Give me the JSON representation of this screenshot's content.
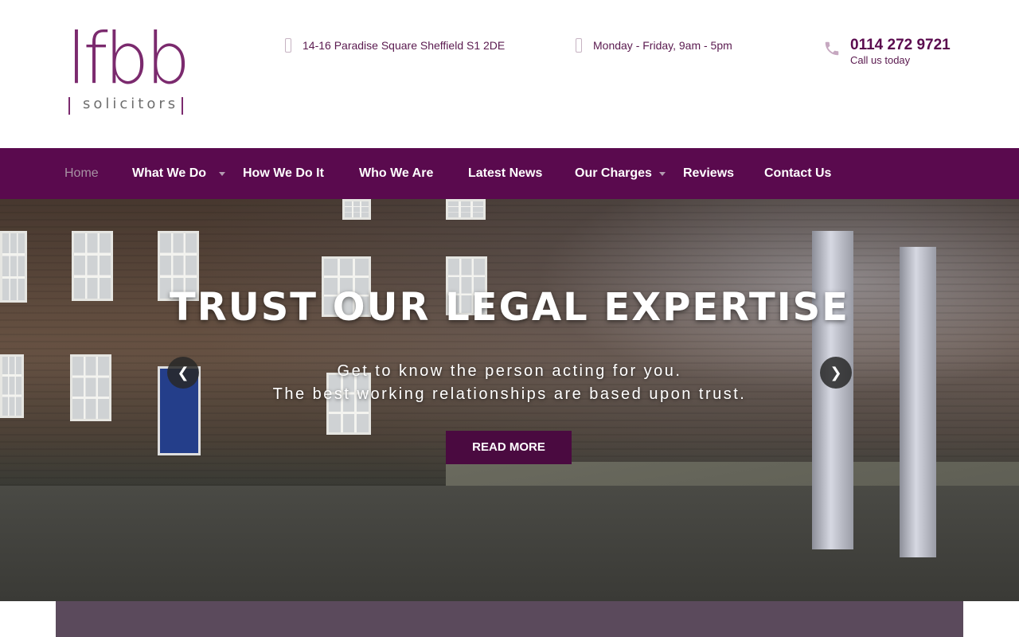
{
  "header": {
    "logo": {
      "word": "lfbb",
      "sub": "solicitors"
    },
    "address": "14-16 Paradise Square Sheffield S1 2DE",
    "hours": "Monday - Friday, 9am - 5pm",
    "phone": {
      "number": "0114 272 9721",
      "sub": "Call us today",
      "icon": "phone-icon"
    }
  },
  "nav": {
    "items": [
      {
        "label": "Home",
        "active": true
      },
      {
        "label": "What We Do",
        "has_dropdown": true
      },
      {
        "label": "How We Do It"
      },
      {
        "label": "Who We Are"
      },
      {
        "label": "Latest News"
      },
      {
        "label": "Our Charges",
        "has_dropdown": true
      },
      {
        "label": "Reviews"
      },
      {
        "label": "Contact Us"
      }
    ]
  },
  "hero": {
    "title": "TRUST OUR LEGAL EXPERTISE",
    "line1": "Get to know the person acting for you.",
    "line2": "The best working relationships are based upon trust.",
    "button": "READ MORE",
    "prev_icon": "chevron-left-icon",
    "next_icon": "chevron-right-icon"
  },
  "colors": {
    "brand": "#5a0a4e",
    "logo": "#7b2a6e",
    "button": "#4a0a40",
    "bottom_bar": "#5b4a5c"
  }
}
